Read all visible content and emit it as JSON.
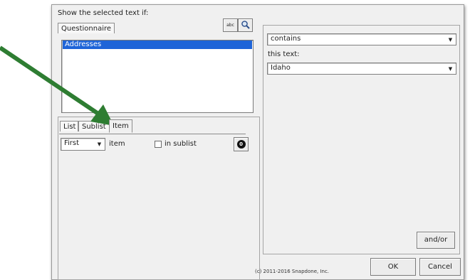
{
  "dialog": {
    "heading": "Show the selected text if:",
    "left_tabs": [
      "Questionnaire"
    ],
    "tool_abc_label": "abc",
    "questionnaire_items": [
      {
        "label": "Addresses",
        "selected": true
      }
    ],
    "sub_tabs": [
      "List",
      "Sublist",
      "Item"
    ],
    "active_sub_tab": "Item",
    "item_selector": {
      "value": "First",
      "suffix": "item",
      "in_sublist_label": "in sublist",
      "in_sublist_checked": false,
      "badge": "0"
    },
    "condition": {
      "operator": "contains",
      "this_text_label": "this text:",
      "value": "Idaho"
    },
    "and_or_label": "and/or",
    "copyright": "(c) 2011-2016 Snapdone, Inc.",
    "ok_label": "OK",
    "cancel_label": "Cancel"
  },
  "annotation": {
    "arrow_color": "#2e7d32",
    "icon": "arrow-icon"
  }
}
